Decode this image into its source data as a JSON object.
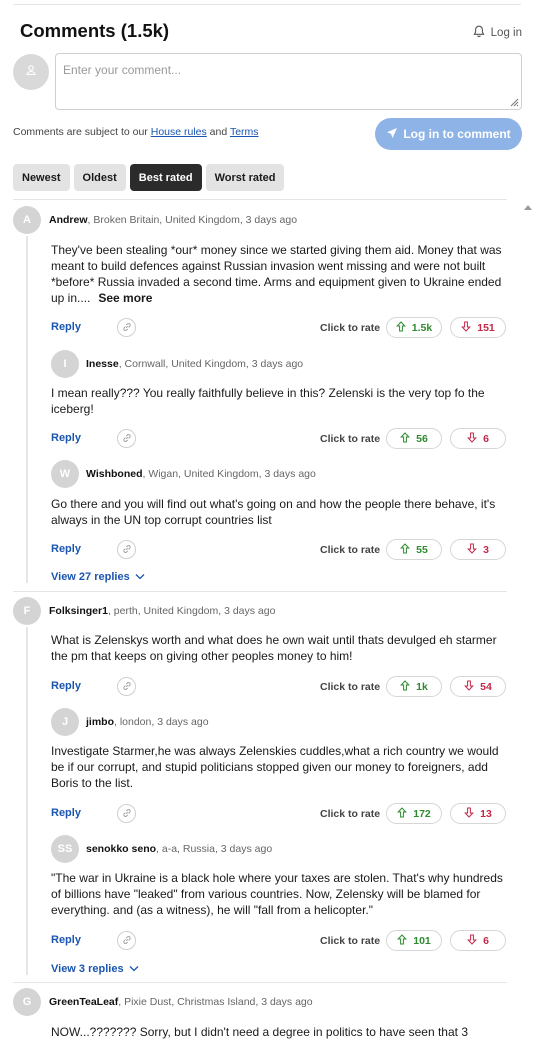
{
  "header": {
    "title": "Comments (1.5k)",
    "login_label": "Log in"
  },
  "composer": {
    "placeholder": "Enter your comment...",
    "rules_prefix": "Comments are subject to our ",
    "house_rules": "House rules",
    "and": " and ",
    "terms": "Terms",
    "login_button": "Log in to comment"
  },
  "sort": {
    "tabs": [
      "Newest",
      "Oldest",
      "Best rated",
      "Worst rated"
    ],
    "active": "Best rated"
  },
  "actions": {
    "reply": "Reply",
    "rate": "Click to rate",
    "see_more": "See more"
  },
  "colors": {
    "accent": "#1a56b0",
    "upvote": "#2f8a2f",
    "downvote": "#c3284a",
    "login_button": "#8eb3e6"
  },
  "comments": [
    {
      "initial": "A",
      "name": "Andrew",
      "meta": ", Broken Britain, United Kingdom, 3 days ago",
      "text": "They've been stealing *our* money since we started giving them aid. Money that was meant to build defences against Russian invasion went missing and were not built *before* Russia invaded a second time. Arms and equipment given to Ukraine ended up in....",
      "up": "1.5k",
      "down": "151"
    },
    {
      "initial": "I",
      "name": "Inesse",
      "meta": ", Cornwall, United Kingdom, 3 days ago",
      "text": "I mean really??? You really faithfully believe in this? Zelenski is the very top fo the iceberg!",
      "up": "56",
      "down": "6"
    },
    {
      "initial": "W",
      "name": "Wishboned",
      "meta": ", Wigan, United Kingdom, 3 days ago",
      "text": "Go there and you will find out what's going on and how the people there behave, it's always in the UN top corrupt countries list",
      "up": "55",
      "down": "3"
    },
    {
      "initial": "F",
      "name": "Folksinger1",
      "meta": ", perth, United Kingdom, 3 days ago",
      "text": "What is Zelenskys worth and what does he own wait until thats devulged eh starmer the pm that keeps on giving other peoples money to him!",
      "up": "1k",
      "down": "54"
    },
    {
      "initial": "J",
      "name": "jimbo",
      "meta": ", london, 3 days ago",
      "text": "Investigate Starmer,he was always Zelenskies cuddles,what a rich country we would be if our corrupt, and stupid politicians stopped given our money to foreigners, add Boris to the list.",
      "up": "172",
      "down": "13"
    },
    {
      "initial": "SS",
      "name": "senokko seno",
      "meta": ", a-a, Russia, 3 days ago",
      "text": "\"The war in Ukraine is a black hole where your taxes are stolen. That's why hundreds of billions have \"leaked\" from various countries. Now, Zelensky will be blamed for everything. and (as a witness), he will \"fall from a helicopter.\"",
      "up": "101",
      "down": "6"
    },
    {
      "initial": "G",
      "name": "GreenTeaLeaf",
      "meta": ", Pixie Dust, Christmas Island, 3 days ago",
      "text": "NOW...??????? Sorry, but I didn't need a degree in politics to have seen that 3"
    }
  ],
  "view_replies": [
    "View 27 replies",
    "View 3 replies"
  ]
}
